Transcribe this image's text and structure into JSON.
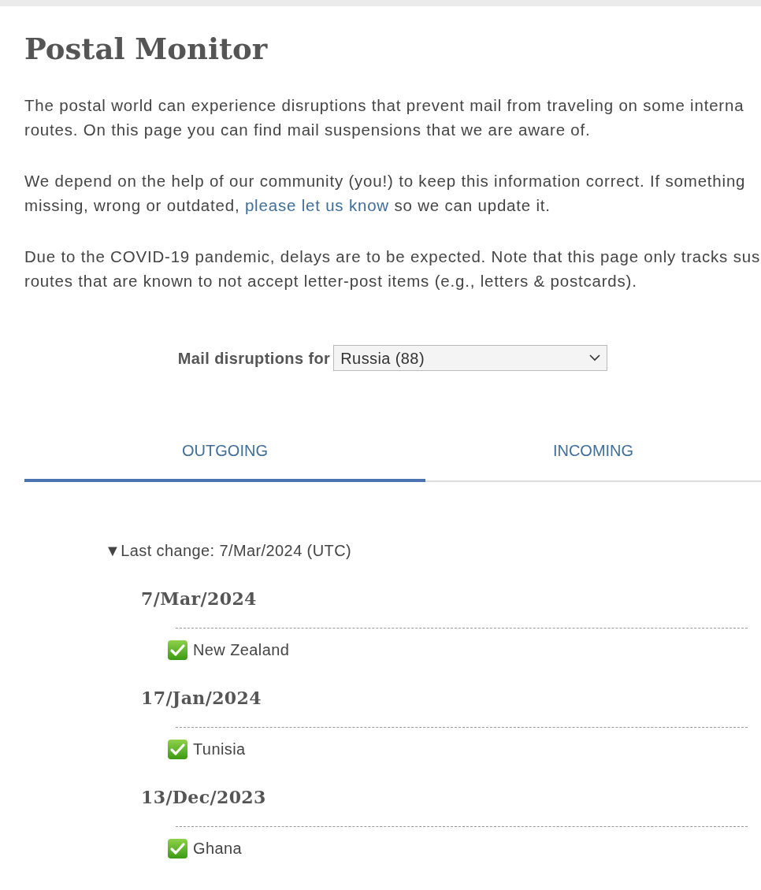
{
  "title": "Postal Monitor",
  "paragraphs": [
    [
      [
        {
          "text": "The postal world can experience disruptions that prevent mail from traveling on some interna"
        }
      ],
      [
        {
          "text": "routes. On this page you can find mail suspensions that we are aware of."
        }
      ]
    ],
    [
      [
        {
          "text": "We depend on the help of our community (you!) to keep this information correct. If something"
        }
      ],
      [
        {
          "text": "missing, wrong or outdated, "
        },
        {
          "text": "please let us know",
          "link": true
        },
        {
          "text": " so we can update it."
        }
      ]
    ],
    [
      [
        {
          "text": "Due to the COVID-19 pandemic, delays are to be expected. Note that this page only tracks sus"
        }
      ],
      [
        {
          "text": "routes that are known to not accept letter-post items (e.g., letters & postcards)."
        }
      ]
    ]
  ],
  "selector": {
    "label": "Mail disruptions for",
    "value": "Russia (88)"
  },
  "tabs": [
    {
      "label": "OUTGOING",
      "selected": true
    },
    {
      "label": "INCOMING",
      "selected": false
    }
  ],
  "changes": {
    "marker": "▼",
    "label": "Last change: 7/Mar/2024 (UTC)",
    "groups": [
      {
        "date": "7/Mar/2024",
        "items": [
          "New Zealand"
        ]
      },
      {
        "date": "17/Jan/2024",
        "items": [
          "Tunisia"
        ]
      },
      {
        "date": "13/Dec/2023",
        "items": [
          "Ghana"
        ]
      }
    ]
  }
}
